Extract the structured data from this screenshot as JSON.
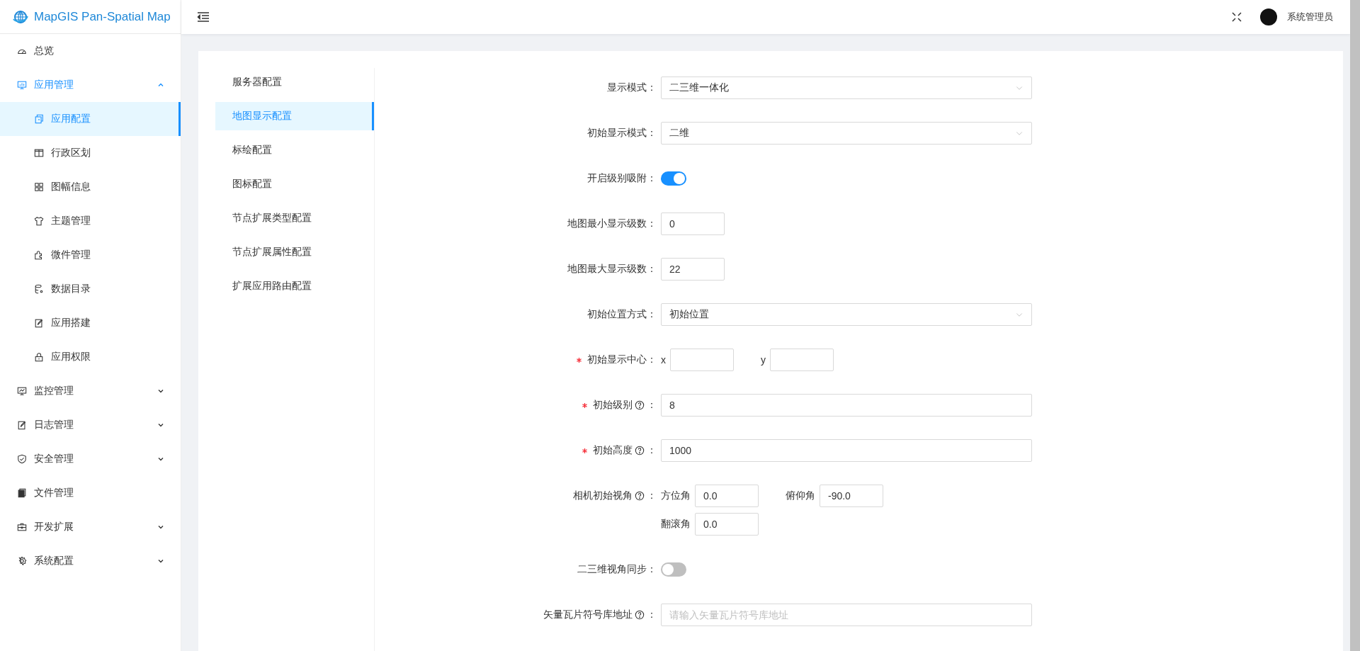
{
  "logo": {
    "text": "MapGIS Pan-Spatial Map"
  },
  "header": {
    "user": "系统管理员"
  },
  "sidebar": {
    "items": [
      {
        "label": "总览",
        "kind": "link",
        "selected": false
      },
      {
        "label": "应用管理",
        "kind": "group",
        "expanded": true,
        "children": [
          {
            "label": "应用配置",
            "selected": true
          },
          {
            "label": "行政区划",
            "selected": false
          },
          {
            "label": "图幅信息",
            "selected": false
          },
          {
            "label": "主题管理",
            "selected": false
          },
          {
            "label": "微件管理",
            "selected": false
          },
          {
            "label": "数据目录",
            "selected": false
          },
          {
            "label": "应用搭建",
            "selected": false
          },
          {
            "label": "应用权限",
            "selected": false
          }
        ]
      },
      {
        "label": "监控管理",
        "kind": "group",
        "expanded": false
      },
      {
        "label": "日志管理",
        "kind": "group",
        "expanded": false
      },
      {
        "label": "安全管理",
        "kind": "group",
        "expanded": false
      },
      {
        "label": "文件管理",
        "kind": "link",
        "selected": false
      },
      {
        "label": "开发扩展",
        "kind": "group",
        "expanded": false
      },
      {
        "label": "系统配置",
        "kind": "group",
        "expanded": false
      }
    ]
  },
  "config_nav": {
    "items": [
      {
        "label": "服务器配置",
        "selected": false
      },
      {
        "label": "地图显示配置",
        "selected": true
      },
      {
        "label": "标绘配置",
        "selected": false
      },
      {
        "label": "图标配置",
        "selected": false
      },
      {
        "label": "节点扩展类型配置",
        "selected": false
      },
      {
        "label": "节点扩展属性配置",
        "selected": false
      },
      {
        "label": "扩展应用路由配置",
        "selected": false
      }
    ]
  },
  "form": {
    "rows": [
      {
        "kind": "select",
        "label": "显示模式：",
        "value": "二三维一体化"
      },
      {
        "kind": "select",
        "label": "初始显示模式：",
        "value": "二维"
      },
      {
        "kind": "switch",
        "label": "开启级别吸附：",
        "on": true
      },
      {
        "kind": "number",
        "label": "地图最小显示级数：",
        "value": "0"
      },
      {
        "kind": "number",
        "label": "地图最大显示级数：",
        "value": "22"
      },
      {
        "kind": "select",
        "label": "初始位置方式：",
        "value": "初始位置"
      },
      {
        "kind": "pair",
        "label": "初始显示中心：",
        "required": true,
        "fields": [
          {
            "label": "x"
          },
          {
            "label": "y"
          }
        ]
      },
      {
        "kind": "text",
        "label": "初始级别",
        "required": true,
        "help": true,
        "suffix": "：",
        "value": "8"
      },
      {
        "kind": "text",
        "label": "初始高度",
        "required": true,
        "help": true,
        "suffix": "：",
        "value": "1000"
      },
      {
        "kind": "camera",
        "label": "相机初始视角",
        "help": true,
        "suffix": "：",
        "fields": [
          {
            "label": "方位角",
            "value": "0.0"
          },
          {
            "label": "俯仰角",
            "value": "-90.0"
          },
          {
            "label": "翻滚角",
            "value": "0.0"
          }
        ]
      },
      {
        "kind": "switch",
        "label": "二三维视角同步：",
        "on": false
      },
      {
        "kind": "text",
        "label": "矢量瓦片符号库地址",
        "help": true,
        "suffix": "：",
        "placeholder": "请输入矢量瓦片符号库地址"
      }
    ]
  }
}
